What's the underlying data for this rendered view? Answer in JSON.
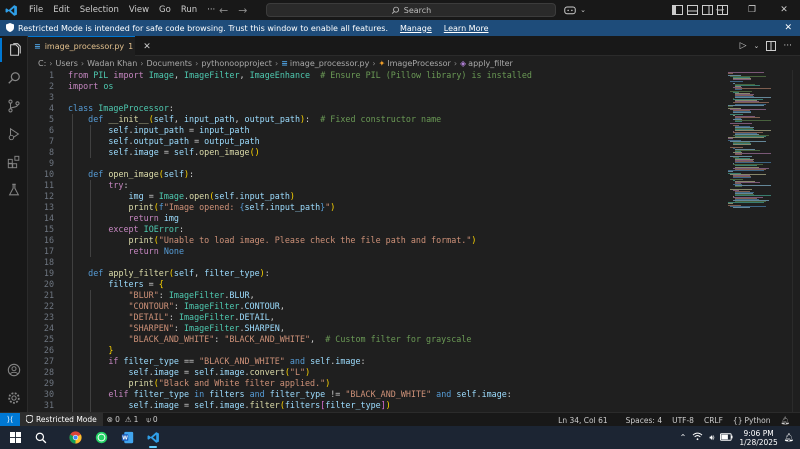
{
  "menu": [
    "File",
    "Edit",
    "Selection",
    "View",
    "Go",
    "Run",
    "···"
  ],
  "search": {
    "label": "Search"
  },
  "banner": {
    "message": "Restricted Mode is intended for safe code browsing. Trust this window to enable all features.",
    "manage": "Manage",
    "learn_more": "Learn More"
  },
  "tab": {
    "icon": "py",
    "name": "image_processor.py",
    "badge": "1"
  },
  "breadcrumb": [
    "C:",
    "Users",
    "Wadan Khan",
    "Documents",
    "pythonoopproject",
    "image_processor.py",
    "ImageProcessor",
    "apply_filter"
  ],
  "code_lines": [
    {
      "n": "1",
      "html": "<span class='kw'>from</span> <span class='cl'>PIL</span> <span class='kw'>import</span> <span class='cl'>Image</span>, <span class='cl'>ImageFilter</span>, <span class='cl'>ImageEnhance</span>  <span class='cm'># Ensure PIL (Pillow library) is installed</span>"
    },
    {
      "n": "2",
      "html": "<span class='kw'>import</span> <span class='cl'>os</span>"
    },
    {
      "n": "3",
      "html": ""
    },
    {
      "n": "4",
      "html": "<span class='dk'>class</span> <span class='cl'>ImageProcessor</span>:"
    },
    {
      "n": "5",
      "html": "    <span class='dk'>def</span> <span class='fn'>__init__</span><span class='bk'>(</span><span class='va'>self</span>, <span class='va'>input_path</span>, <span class='va'>output_path</span><span class='bk'>)</span>:  <span class='cm'># Fixed constructor name</span>"
    },
    {
      "n": "6",
      "html": "        <span class='va'>self</span>.<span class='va'>input_path</span> = <span class='va'>input_path</span>"
    },
    {
      "n": "7",
      "html": "        <span class='va'>self</span>.<span class='va'>output_path</span> = <span class='va'>output_path</span>"
    },
    {
      "n": "8",
      "html": "        <span class='va'>self</span>.<span class='va'>image</span> = <span class='va'>self</span>.<span class='fn'>open_image</span><span class='bk'>()</span>"
    },
    {
      "n": "9",
      "html": ""
    },
    {
      "n": "10",
      "html": "    <span class='dk'>def</span> <span class='fn'>open_image</span><span class='bk'>(</span><span class='va'>self</span><span class='bk'>)</span>:"
    },
    {
      "n": "11",
      "html": "        <span class='kw'>try</span>:"
    },
    {
      "n": "12",
      "html": "            <span class='va'>img</span> = <span class='cl'>Image</span>.<span class='fn'>open</span><span class='bk'>(</span><span class='va'>self</span>.<span class='va'>input_path</span><span class='bk'>)</span>"
    },
    {
      "n": "13",
      "html": "            <span class='fn'>print</span><span class='bk'>(</span><span class='dk'>f</span><span class='st'>\"Image opened: </span><span class='dk'>{</span><span class='va'>self</span>.<span class='va'>input_path</span><span class='dk'>}</span><span class='st'>\"</span><span class='bk'>)</span>"
    },
    {
      "n": "14",
      "html": "            <span class='kw'>return</span> <span class='va'>img</span>"
    },
    {
      "n": "15",
      "html": "        <span class='kw'>except</span> <span class='cl'>IOError</span>:"
    },
    {
      "n": "16",
      "html": "            <span class='fn'>print</span><span class='bk'>(</span><span class='st'>\"Unable to load image. Please check the file path and format.\"</span><span class='bk'>)</span>"
    },
    {
      "n": "17",
      "html": "            <span class='kw'>return</span> <span class='dk'>None</span>"
    },
    {
      "n": "18",
      "html": ""
    },
    {
      "n": "19",
      "html": "    <span class='dk'>def</span> <span class='fn'>apply_filter</span><span class='bk'>(</span><span class='va'>self</span>, <span class='va'>filter_type</span><span class='bk'>)</span>:"
    },
    {
      "n": "20",
      "html": "        <span class='va'>filters</span> = <span class='bk'>{</span>"
    },
    {
      "n": "21",
      "html": "            <span class='st'>\"BLUR\"</span>: <span class='cl'>ImageFilter</span>.<span class='va'>BLUR</span>,"
    },
    {
      "n": "22",
      "html": "            <span class='st'>\"CONTOUR\"</span>: <span class='cl'>ImageFilter</span>.<span class='va'>CONTOUR</span>,"
    },
    {
      "n": "23",
      "html": "            <span class='st'>\"DETAIL\"</span>: <span class='cl'>ImageFilter</span>.<span class='va'>DETAIL</span>,"
    },
    {
      "n": "24",
      "html": "            <span class='st'>\"SHARPEN\"</span>: <span class='cl'>ImageFilter</span>.<span class='va'>SHARPEN</span>,"
    },
    {
      "n": "25",
      "html": "            <span class='st'>\"BLACK_AND_WHITE\"</span>: <span class='st'>\"BLACK_AND_WHITE\"</span>,  <span class='cm'># Custom filter for grayscale</span>"
    },
    {
      "n": "26",
      "html": "        <span class='bk'>}</span>"
    },
    {
      "n": "27",
      "html": "        <span class='kw'>if</span> <span class='va'>filter_type</span> == <span class='st'>\"BLACK_AND_WHITE\"</span> <span class='dk'>and</span> <span class='va'>self</span>.<span class='va'>image</span>:"
    },
    {
      "n": "28",
      "html": "            <span class='va'>self</span>.<span class='va'>image</span> = <span class='va'>self</span>.<span class='va'>image</span>.<span class='fn'>convert</span><span class='bk'>(</span><span class='st'>\"L\"</span><span class='bk'>)</span>"
    },
    {
      "n": "29",
      "html": "            <span class='fn'>print</span><span class='bk'>(</span><span class='st'>\"Black and White filter applied.\"</span><span class='bk'>)</span>"
    },
    {
      "n": "30",
      "html": "        <span class='kw'>elif</span> <span class='va'>filter_type</span> <span class='dk'>in</span> <span class='va'>filters</span> <span class='dk'>and</span> <span class='va'>filter_type</span> != <span class='st'>\"BLACK_AND_WHITE\"</span> <span class='dk'>and</span> <span class='va'>self</span>.<span class='va'>image</span>:"
    },
    {
      "n": "31",
      "html": "            <span class='va'>self</span>.<span class='va'>image</span> = <span class='va'>self</span>.<span class='va'>image</span>.<span class='fn'>filter</span><span class='bk'>(</span><span class='va'>filters</span><span class='bk2'>[</span><span class='va'>filter_type</span><span class='bk2'>]</span><span class='bk'>)</span>"
    }
  ],
  "statusbar": {
    "mode": "Restricted Mode",
    "errors": "0",
    "warnings": "1",
    "ports": "0",
    "position": "Ln 34, Col 61",
    "spaces": "Spaces: 4",
    "encoding": "UTF-8",
    "eol": "CRLF",
    "language": "Python"
  },
  "taskbar": {
    "time": "9:06 PM",
    "date": "1/28/2025"
  },
  "colors": {
    "accent": "#0078d4",
    "banner": "#1e4c7a",
    "editor_bg": "#1f1f1f"
  }
}
